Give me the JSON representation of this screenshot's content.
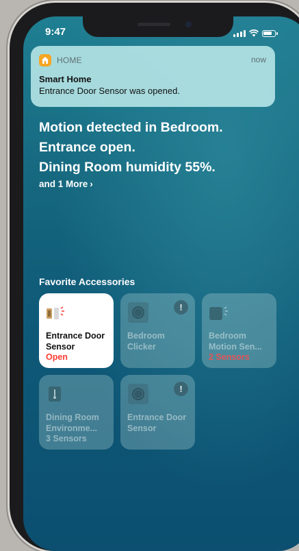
{
  "status_bar": {
    "time": "9:47"
  },
  "notification": {
    "app_name": "HOME",
    "time": "now",
    "title": "Smart Home",
    "body": "Entrance Door Sensor was opened."
  },
  "summary": {
    "lines": [
      "Motion detected in Bedroom.",
      "Entrance open.",
      "Dining Room humidity 55%."
    ],
    "more_label": "and 1 More",
    "more_chevron": "›"
  },
  "favorites": {
    "title": "Favorite Accessories",
    "tiles": [
      {
        "name": "Entrance Door Sensor",
        "status": "Open",
        "icon": "door-sensor-icon",
        "active": true
      },
      {
        "name": "Bedroom Clicker",
        "status": "",
        "icon": "clicker-icon",
        "badge": "!"
      },
      {
        "name": "Bedroom Motion Sen...",
        "status": "2 Sensors",
        "icon": "motion-sensor-icon"
      },
      {
        "name": "Dining Room Environme...",
        "status": "3 Sensors",
        "icon": "thermometer-icon"
      },
      {
        "name": "Entrance Door Sensor",
        "status": "",
        "icon": "clicker-icon",
        "badge": "!"
      }
    ]
  },
  "colors": {
    "accent_red": "#ff3b30",
    "home_icon": "#f5a623"
  }
}
